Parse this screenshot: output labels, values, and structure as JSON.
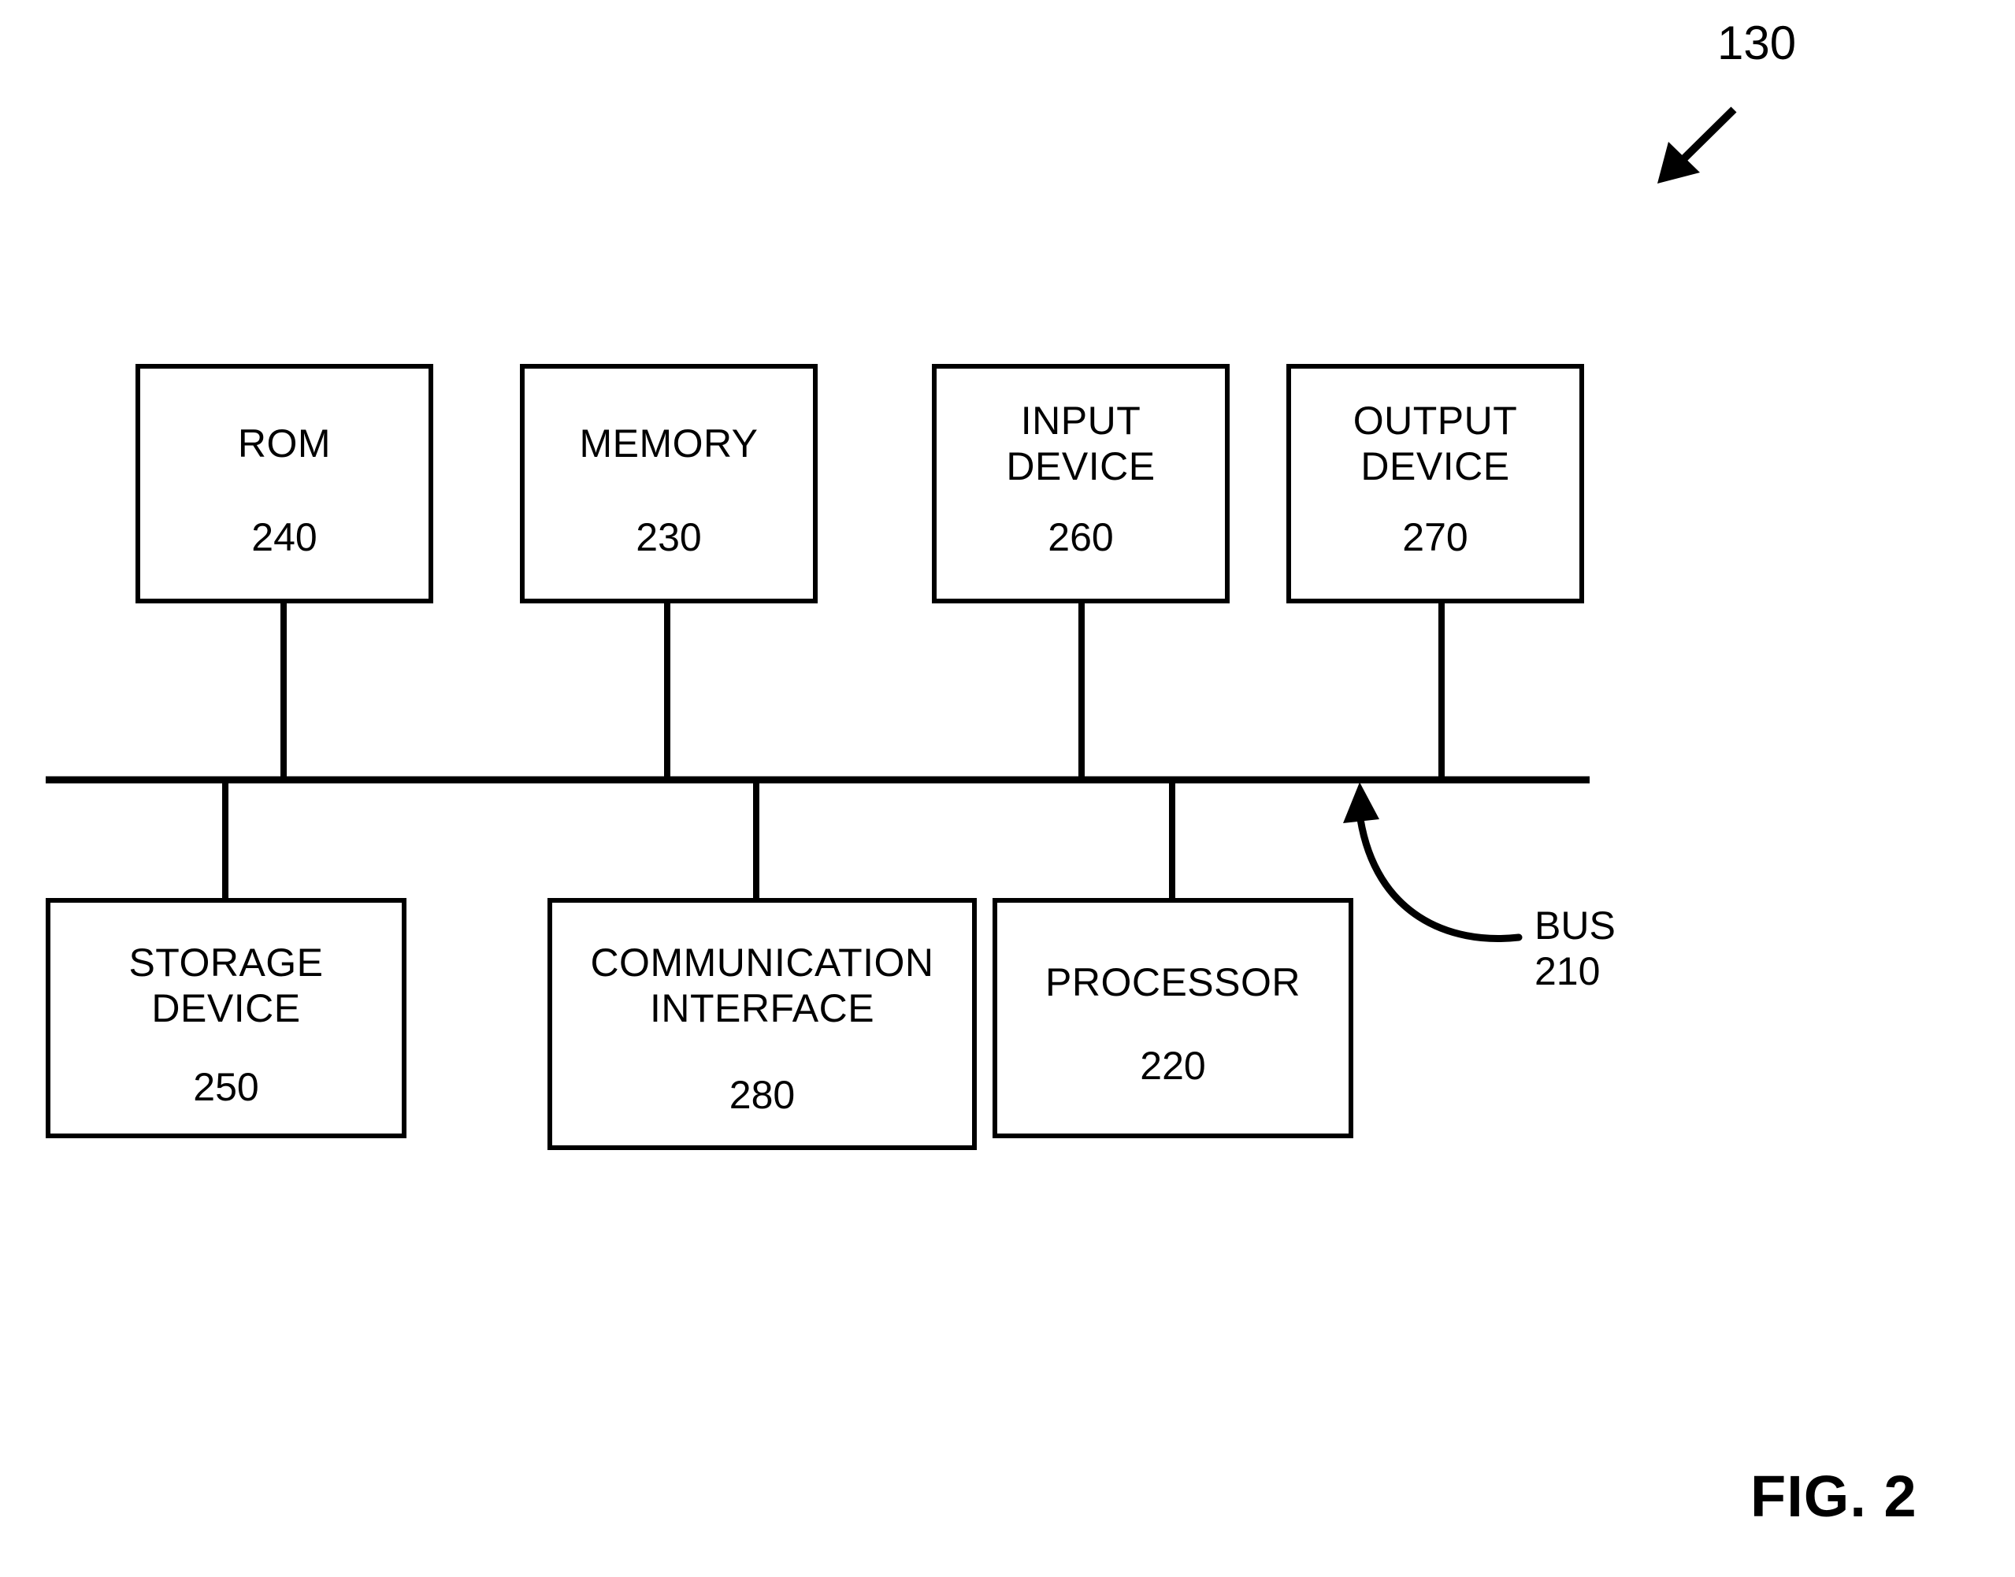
{
  "figure": {
    "caption": "FIG. 2",
    "system_ref": "130",
    "bus": {
      "label": "BUS",
      "ref": "210"
    }
  },
  "nodes": {
    "rom": {
      "title": "ROM",
      "ref": "240"
    },
    "memory": {
      "title": "MEMORY",
      "ref": "230"
    },
    "input": {
      "title": "INPUT\nDEVICE",
      "ref": "260"
    },
    "output": {
      "title": "OUTPUT\nDEVICE",
      "ref": "270"
    },
    "storage": {
      "title": "STORAGE\nDEVICE",
      "ref": "250"
    },
    "comm": {
      "title": "COMMUNICATION\nINTERFACE",
      "ref": "280"
    },
    "processor": {
      "title": "PROCESSOR",
      "ref": "220"
    }
  },
  "style": {
    "stroke": "#000000",
    "background": "#ffffff"
  }
}
